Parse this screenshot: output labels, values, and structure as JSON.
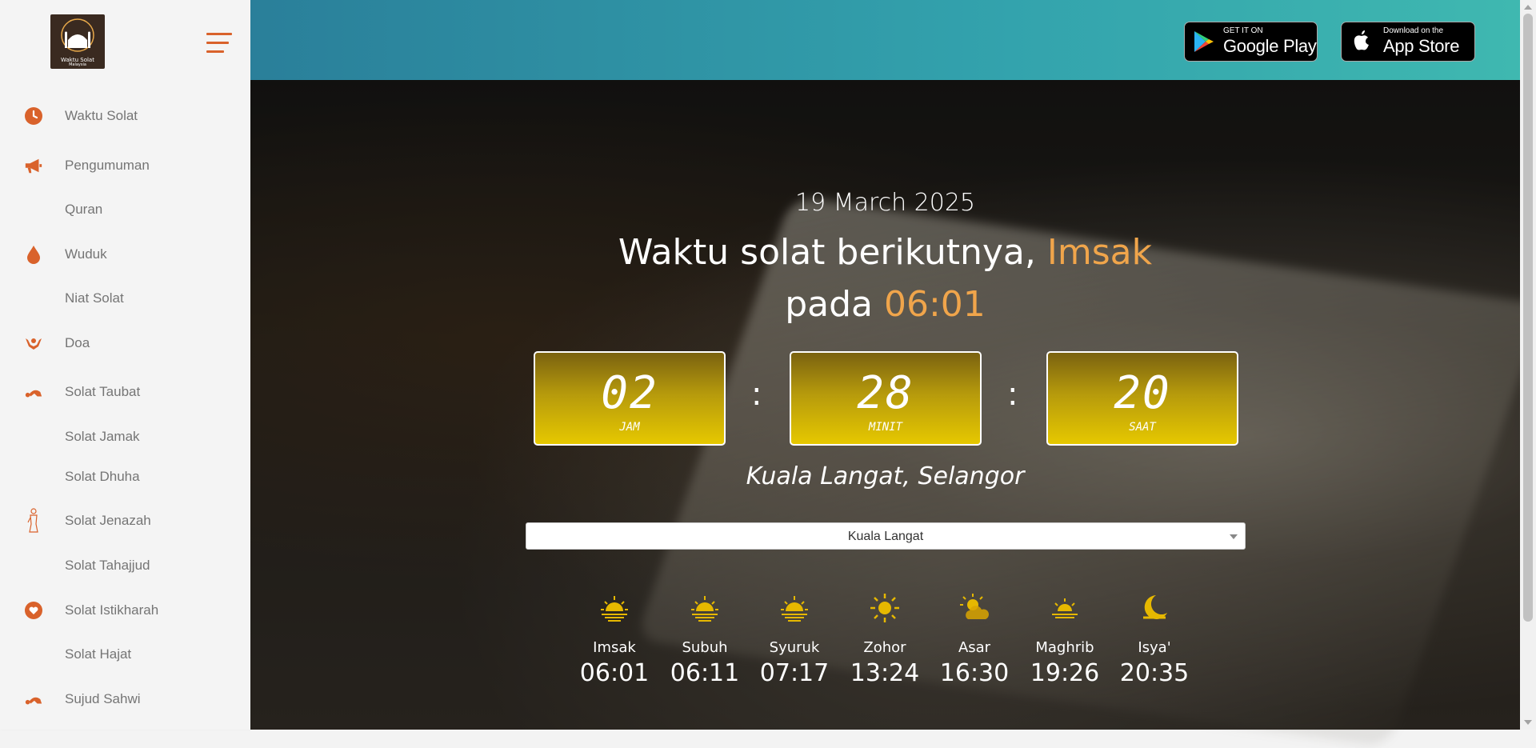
{
  "sidebar": {
    "logo_text": "Waktu Solat",
    "logo_sub": "Malaysia",
    "menu_icon": "hamburger-menu-icon",
    "accent_color": "#d9622b",
    "items": [
      {
        "label": "Waktu Solat",
        "icon": "clock-icon"
      },
      {
        "label": "Pengumuman",
        "icon": "megaphone-icon"
      },
      {
        "label": "Quran",
        "icon": ""
      },
      {
        "label": "Wuduk",
        "icon": "water-drop-icon"
      },
      {
        "label": "Niat Solat",
        "icon": ""
      },
      {
        "label": "Doa",
        "icon": "praying-hands-icon"
      },
      {
        "label": "Solat Taubat",
        "icon": "prostration-icon"
      },
      {
        "label": "Solat Jamak",
        "icon": ""
      },
      {
        "label": "Solat Dhuha",
        "icon": ""
      },
      {
        "label": "Solat Jenazah",
        "icon": "standing-prayer-icon"
      },
      {
        "label": "Solat Tahajjud",
        "icon": ""
      },
      {
        "label": "Solat Istikharah",
        "icon": "heart-icon"
      },
      {
        "label": "Solat Hajat",
        "icon": ""
      },
      {
        "label": "Sujud Sahwi",
        "icon": "prostration-icon"
      }
    ]
  },
  "header": {
    "google_play": {
      "small": "GET IT ON",
      "big": "Google Play"
    },
    "app_store": {
      "small": "Download on the",
      "big": "App Store"
    }
  },
  "main": {
    "date": "19 March 2025",
    "next_prefix": "Waktu solat berikutnya,",
    "next_prayer": "Imsak",
    "at_prefix": "pada",
    "next_time": "06:01",
    "countdown": [
      {
        "value": "02",
        "label": "JAM"
      },
      {
        "value": "28",
        "label": "MINIT"
      },
      {
        "value": "20",
        "label": "SAAT"
      }
    ],
    "separator": ":",
    "location": "Kuala Langat, Selangor",
    "zone_select": "Kuala Langat",
    "highlight_color": "#f0a54b",
    "prayers": [
      {
        "name": "Imsak",
        "time": "06:01",
        "icon": "sunrise-icon"
      },
      {
        "name": "Subuh",
        "time": "06:11",
        "icon": "sunrise-icon"
      },
      {
        "name": "Syuruk",
        "time": "07:17",
        "icon": "sunrise-icon"
      },
      {
        "name": "Zohor",
        "time": "13:24",
        "icon": "sun-icon"
      },
      {
        "name": "Asar",
        "time": "16:30",
        "icon": "sun-cloud-icon"
      },
      {
        "name": "Maghrib",
        "time": "19:26",
        "icon": "sunset-icon"
      },
      {
        "name": "Isya'",
        "time": "20:35",
        "icon": "moon-icon"
      }
    ]
  }
}
